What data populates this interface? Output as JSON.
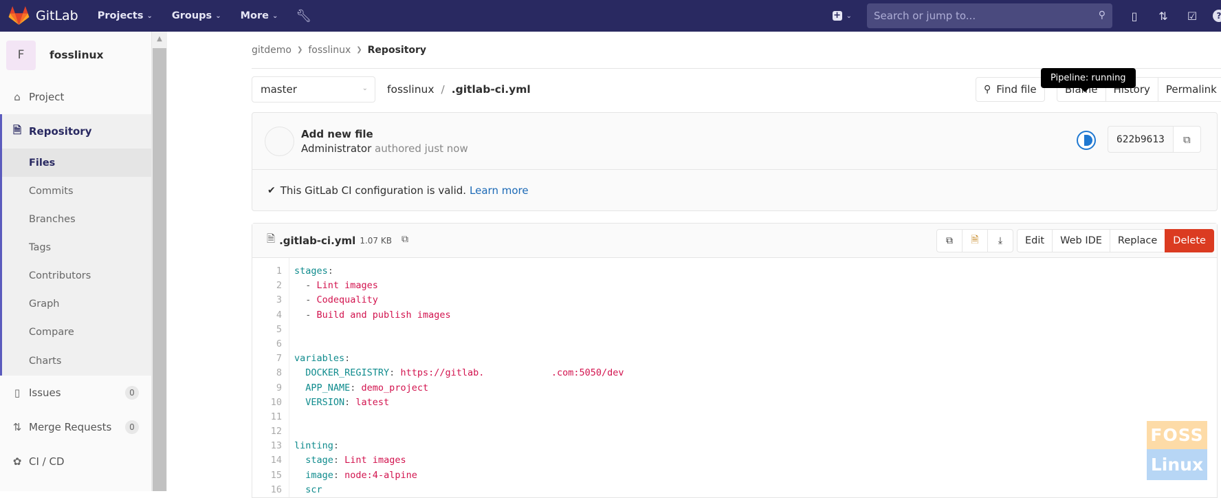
{
  "navbar": {
    "brand": "GitLab",
    "items": [
      {
        "label": "Projects",
        "icon": "chevron-down-icon"
      },
      {
        "label": "Groups",
        "icon": "chevron-down-icon"
      },
      {
        "label": "More",
        "icon": "chevron-down-icon"
      }
    ],
    "admin_icon": "wrench-icon",
    "new_icon": "plus-square-icon",
    "search_placeholder": "Search or jump to...",
    "right_icons": [
      "issues-icon",
      "merge-request-icon",
      "todo-icon",
      "help-icon"
    ],
    "brand_color": "#292961"
  },
  "sidebar": {
    "project_initial": "F",
    "project_name": "fosslinux",
    "items": [
      {
        "label": "Project",
        "icon": "home-icon"
      },
      {
        "label": "Repository",
        "icon": "document-icon",
        "active": true,
        "children": [
          "Files",
          "Commits",
          "Branches",
          "Tags",
          "Contributors",
          "Graph",
          "Compare",
          "Charts"
        ],
        "active_child": "Files"
      },
      {
        "label": "Issues",
        "icon": "issues-icon",
        "count": "0"
      },
      {
        "label": "Merge Requests",
        "icon": "merge-request-icon",
        "count": "0"
      },
      {
        "label": "CI / CD",
        "icon": "rocket-icon"
      }
    ]
  },
  "breadcrumb": [
    "gitdemo",
    "fosslinux",
    "Repository"
  ],
  "tree": {
    "branch": "master",
    "path_root": "fosslinux",
    "path_sep": "/",
    "path_file": ".gitlab-ci.yml",
    "find_file": "Find file",
    "buttons": [
      "Blame",
      "History",
      "Permalink"
    ]
  },
  "commit": {
    "title": "Add new file",
    "author": "Administrator",
    "authored": "authored just now",
    "pipeline_tooltip": "Pipeline: running",
    "pipeline_status": "running",
    "sha": "622b9613",
    "ci_valid_text": "This GitLab CI configuration is valid.",
    "learn_more": "Learn more"
  },
  "file": {
    "name": ".gitlab-ci.yml",
    "size": "1.07 KB",
    "icon_actions": [
      "copy-icon",
      "raw-icon",
      "download-icon"
    ],
    "actions": [
      "Edit",
      "Web IDE",
      "Replace",
      "Delete"
    ],
    "lines": [
      {
        "n": "1",
        "parts": [
          [
            "k",
            "stages"
          ],
          [
            "p",
            ":"
          ]
        ]
      },
      {
        "n": "2",
        "parts": [
          [
            "p",
            "  - "
          ],
          [
            "s",
            "Lint images"
          ]
        ]
      },
      {
        "n": "3",
        "parts": [
          [
            "p",
            "  - "
          ],
          [
            "s",
            "Codequality"
          ]
        ]
      },
      {
        "n": "4",
        "parts": [
          [
            "p",
            "  - "
          ],
          [
            "s",
            "Build and publish images"
          ]
        ]
      },
      {
        "n": "5",
        "parts": []
      },
      {
        "n": "6",
        "parts": []
      },
      {
        "n": "7",
        "parts": [
          [
            "k",
            "variables"
          ],
          [
            "p",
            ":"
          ]
        ]
      },
      {
        "n": "8",
        "parts": [
          [
            "k",
            "  DOCKER_REGISTRY"
          ],
          [
            "p",
            ": "
          ],
          [
            "s",
            "https://gitlab.            .com:5050/dev"
          ]
        ]
      },
      {
        "n": "9",
        "parts": [
          [
            "k",
            "  APP_NAME"
          ],
          [
            "p",
            ": "
          ],
          [
            "s",
            "demo_project"
          ]
        ]
      },
      {
        "n": "10",
        "parts": [
          [
            "k",
            "  VERSION"
          ],
          [
            "p",
            ": "
          ],
          [
            "s",
            "latest"
          ]
        ]
      },
      {
        "n": "11",
        "parts": []
      },
      {
        "n": "12",
        "parts": []
      },
      {
        "n": "13",
        "parts": [
          [
            "k",
            "linting"
          ],
          [
            "p",
            ":"
          ]
        ]
      },
      {
        "n": "14",
        "parts": [
          [
            "k",
            "  stage"
          ],
          [
            "p",
            ": "
          ],
          [
            "s",
            "Lint images"
          ]
        ]
      },
      {
        "n": "15",
        "parts": [
          [
            "k",
            "  image"
          ],
          [
            "p",
            ": "
          ],
          [
            "s",
            "node:4-alpine"
          ]
        ]
      },
      {
        "n": "16",
        "parts": [
          [
            "k",
            "  scr"
          ]
        ]
      }
    ]
  },
  "watermark": {
    "top": "FOSS",
    "bottom": "Linux"
  }
}
